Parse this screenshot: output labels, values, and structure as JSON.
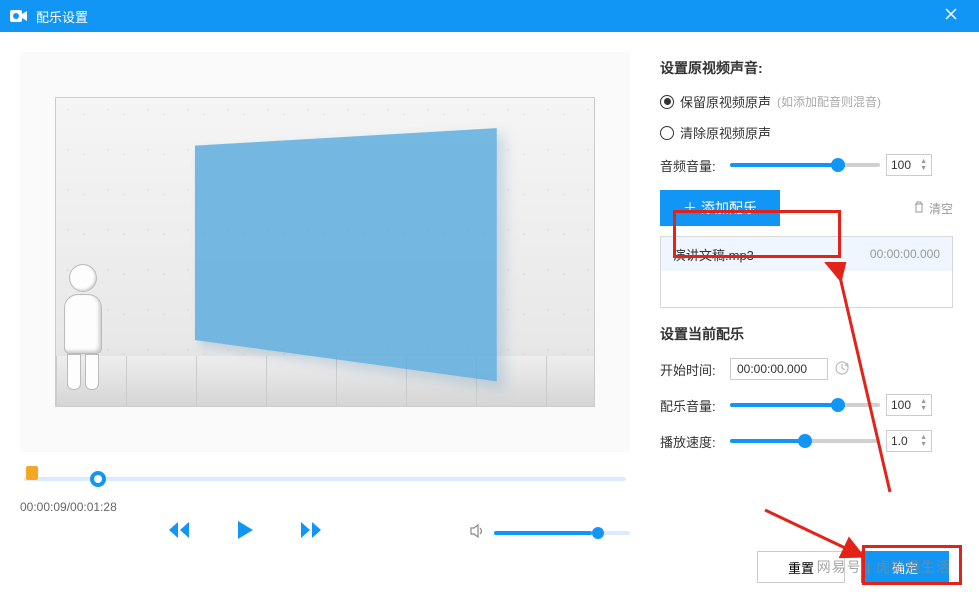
{
  "window": {
    "title": "配乐设置"
  },
  "video": {
    "currentTime": "00:00:09",
    "duration": "00:01:28",
    "timeDisplay": "00:00:09/00:01:28"
  },
  "originalSound": {
    "section_title": "设置原视频声音:",
    "option_keep": "保留原视频原声",
    "option_keep_hint": "(如添加配音则混音)",
    "option_clear": "清除原视频原声",
    "volume_label": "音频音量:",
    "volume_value": "100"
  },
  "music": {
    "add_label": "添加配乐",
    "clear_label": "清空",
    "items": [
      {
        "name": "演讲文稿.mp3",
        "duration": "00:00:00.000"
      }
    ]
  },
  "currentMusic": {
    "section_title": "设置当前配乐",
    "start_label": "开始时间:",
    "start_value": "00:00:00.000",
    "volume_label": "配乐音量:",
    "volume_value": "100",
    "speed_label": "播放速度:",
    "speed_value": "1.0"
  },
  "footer": {
    "reset": "重置",
    "ok": "确定"
  },
  "watermark": "网易号 | 虎哥慢生活"
}
